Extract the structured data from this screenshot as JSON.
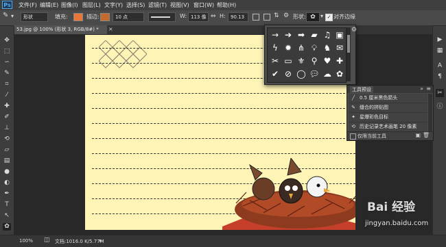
{
  "app": {
    "logo": "Ps"
  },
  "menu": [
    "文件(F)",
    "编辑(E)",
    "图像(I)",
    "图层(L)",
    "文字(Y)",
    "选择(S)",
    "滤镜(T)",
    "视图(V)",
    "窗口(W)",
    "帮助(H)"
  ],
  "options": {
    "mode": "形状",
    "fill_label": "填充:",
    "stroke_label": "描边:",
    "stroke_size": "10 点",
    "w_label": "W:",
    "w_value": "113 像",
    "h_label": "H:",
    "h_value": "90.13",
    "shape_label": "形状:",
    "align_edges": "对齐边缘",
    "fill_color": "#e8773a",
    "stroke_color": "#c46a2c"
  },
  "document": {
    "tab_title": "53.jpg @ 100% (形状 3, RGB/8#) *",
    "close": "×"
  },
  "presets": {
    "items": [
      {
        "icon": "╱",
        "label": "0.5 厘米黑色箭头"
      },
      {
        "icon": "✎",
        "label": "缝合的拼贴图"
      },
      {
        "icon": "✦",
        "label": "星爆彩色目标"
      },
      {
        "icon": "⟲",
        "label": "历史记录艺术画笔 20 像素"
      }
    ],
    "footer_checkbox_label": "仅限当前工具"
  },
  "status": {
    "zoom": "100%",
    "doc_info": "文档:1016.0 K/5.77M"
  },
  "watermark": {
    "brand": "Bai 经验",
    "url": "jingyan.baidu.com"
  },
  "colors": {
    "canvas": "#fdf4b6",
    "panel": "#3d3d3d",
    "accent": "#5aa9e6"
  }
}
